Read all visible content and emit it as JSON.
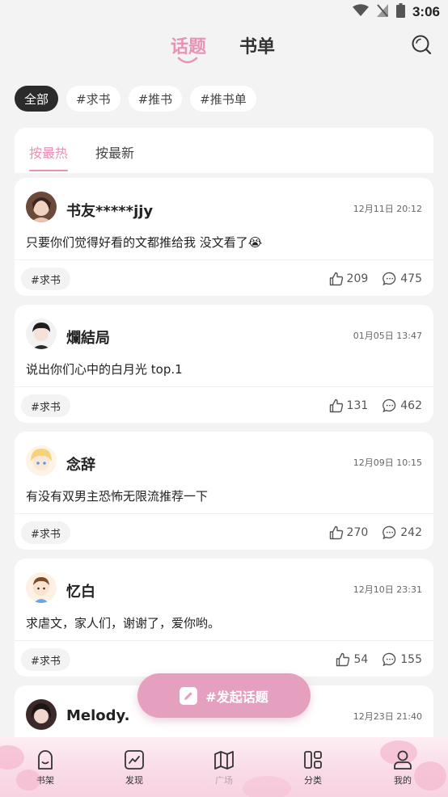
{
  "status_bar": {
    "time": "3:06",
    "icons": [
      "wifi-icon",
      "signal-off-icon",
      "battery-icon"
    ]
  },
  "header": {
    "tabs": [
      {
        "label": "话题",
        "active": true
      },
      {
        "label": "书单",
        "active": false
      }
    ],
    "search_icon": "search-icon"
  },
  "filter_chips": [
    {
      "label": "全部",
      "active": true
    },
    {
      "label": "#求书",
      "active": false
    },
    {
      "label": "#推书",
      "active": false
    },
    {
      "label": "#推书单",
      "active": false
    }
  ],
  "sort_tabs": [
    {
      "label": "按最热",
      "active": true
    },
    {
      "label": "按最新",
      "active": false
    }
  ],
  "posts": [
    {
      "user": "书友*****jjy",
      "time": "12月11日 20:12",
      "text": "只要你们觉得好看的文都推给我 没文看了😭",
      "tag": "#求书",
      "likes": "209",
      "comments": "475"
    },
    {
      "user": "爛結局",
      "time": "01月05日 13:47",
      "text": "说出你们心中的白月光 top.1",
      "tag": "#求书",
      "likes": "131",
      "comments": "462"
    },
    {
      "user": "念辞",
      "time": "12月09日 10:15",
      "text": "有没有双男主恐怖无限流推荐一下",
      "tag": "#求书",
      "likes": "270",
      "comments": "242"
    },
    {
      "user": "忆白",
      "time": "12月10日 23:31",
      "text": "求虐文，家人们，谢谢了，爱你哟。",
      "tag": "#求书",
      "likes": "54",
      "comments": "155"
    },
    {
      "user": "Melody.",
      "time": "12月23日 21:40"
    }
  ],
  "fab": {
    "label": "#发起话题",
    "icon": "edit-icon"
  },
  "bottom_nav": [
    {
      "label": "书架",
      "icon": "bookshelf-icon",
      "active": false
    },
    {
      "label": "发现",
      "icon": "trend-icon",
      "active": false
    },
    {
      "label": "广场",
      "icon": "map-icon",
      "active": true
    },
    {
      "label": "分类",
      "icon": "category-icon",
      "active": false
    },
    {
      "label": "我的",
      "icon": "profile-icon",
      "active": false
    }
  ],
  "colors": {
    "accent": "#e693b6",
    "background": "#f3f3f3",
    "card": "#ffffff",
    "chip_active": "#2b2b2b",
    "fab": "#e6a0bf"
  }
}
